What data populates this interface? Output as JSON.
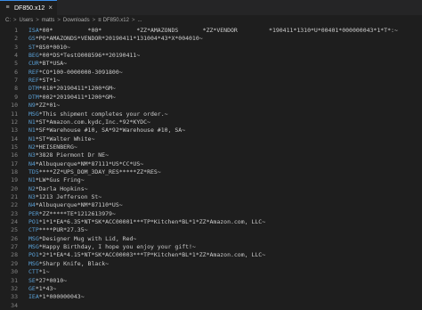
{
  "tab": {
    "title": "DF850.x12",
    "file_icon": "≡",
    "close_icon": "×"
  },
  "breadcrumb": {
    "parts": [
      "C:",
      "Users",
      "matts",
      "Downloads",
      "DF850.x12",
      "..."
    ],
    "separator": ">"
  },
  "lines": [
    {
      "n": "1",
      "seg": "ISA",
      "rest": "*00*          *00*          *ZZ*AMAZONDS       *ZZ*VENDOR         *190411*1310*U*00401*000000043*1*T*:~"
    },
    {
      "n": "2",
      "seg": "GS",
      "rest": "*PO*AMAZONDS*VENDOR*20190411*131004*43*X*004010~"
    },
    {
      "n": "3",
      "seg": "ST",
      "rest": "*850*0010~"
    },
    {
      "n": "4",
      "seg": "BEG",
      "rest": "*00*DS*TestO008596**20190411~"
    },
    {
      "n": "5",
      "seg": "CUR",
      "rest": "*BT*USA~"
    },
    {
      "n": "6",
      "seg": "REF",
      "rest": "*CO*100-0000000-3091800~"
    },
    {
      "n": "7",
      "seg": "REF",
      "rest": "*ST*1~"
    },
    {
      "n": "8",
      "seg": "DTM",
      "rest": "*010*20190411*1200*GM~"
    },
    {
      "n": "9",
      "seg": "DTM",
      "rest": "*002*20190411*1200*GM~"
    },
    {
      "n": "10",
      "seg": "N9",
      "rest": "*ZZ*01~"
    },
    {
      "n": "11",
      "seg": "MSG",
      "rest": "*This shipment completes your order.~"
    },
    {
      "n": "12",
      "seg": "N1",
      "rest": "*ST*Amazon.com.kydc,Inc.*92*KYDC~"
    },
    {
      "n": "13",
      "seg": "N1",
      "rest": "*SF*Warehouse #10, SA*92*Warehouse #10, SA~"
    },
    {
      "n": "14",
      "seg": "N1",
      "rest": "*ST*Walter White~"
    },
    {
      "n": "15",
      "seg": "N2",
      "rest": "*HEISENBERG~"
    },
    {
      "n": "16",
      "seg": "N3",
      "rest": "*3828 Piermont Dr NE~"
    },
    {
      "n": "17",
      "seg": "N4",
      "rest": "*Albuquerque*NM*87111*US*CC*US~"
    },
    {
      "n": "18",
      "seg": "TD5",
      "rest": "****ZZ*UPS_DOM_3DAY_RES*****ZZ*RES~"
    },
    {
      "n": "19",
      "seg": "N1",
      "rest": "*LW*Gus Fring~"
    },
    {
      "n": "20",
      "seg": "N2",
      "rest": "*Darla Hopkins~"
    },
    {
      "n": "21",
      "seg": "N3",
      "rest": "*1213 Jefferson St~"
    },
    {
      "n": "22",
      "seg": "N4",
      "rest": "*Albuquerque*NM*87110*US~"
    },
    {
      "n": "23",
      "seg": "PER",
      "rest": "*ZZ*****TE*1212613979~"
    },
    {
      "n": "24",
      "seg": "PO1",
      "rest": "*1*1*EA*6.35*NT*SK*ACC00001***TP*Kitchen*BL*1*ZZ*Amazon.com, LLC~"
    },
    {
      "n": "25",
      "seg": "CTP",
      "rest": "****PUR*27.35~"
    },
    {
      "n": "26",
      "seg": "MSG",
      "rest": "*Designer Mug with Lid, Red~"
    },
    {
      "n": "27",
      "seg": "MSG",
      "rest": "*Happy Birthday, I hope you enjoy your gift!~"
    },
    {
      "n": "28",
      "seg": "PO1",
      "rest": "*2*1*EA*4.15*NT*SK*ACC00003***TP*Kitchen*BL*1*ZZ*Amazon.com, LLC~"
    },
    {
      "n": "29",
      "seg": "MSG",
      "rest": "*Sharp Knife, Black~"
    },
    {
      "n": "30",
      "seg": "CTT",
      "rest": "*1~"
    },
    {
      "n": "31",
      "seg": "SE",
      "rest": "*27*0010~"
    },
    {
      "n": "32",
      "seg": "GE",
      "rest": "*1*43~"
    },
    {
      "n": "33",
      "seg": "IEA",
      "rest": "*1*000000043~"
    },
    {
      "n": "34",
      "seg": "",
      "rest": ""
    }
  ],
  "colors": {
    "background": "#1e1e1e",
    "segment": "#5aa0d6",
    "text": "#cccccc",
    "line_number": "#858585",
    "tab_accent": "#3b8eea"
  }
}
